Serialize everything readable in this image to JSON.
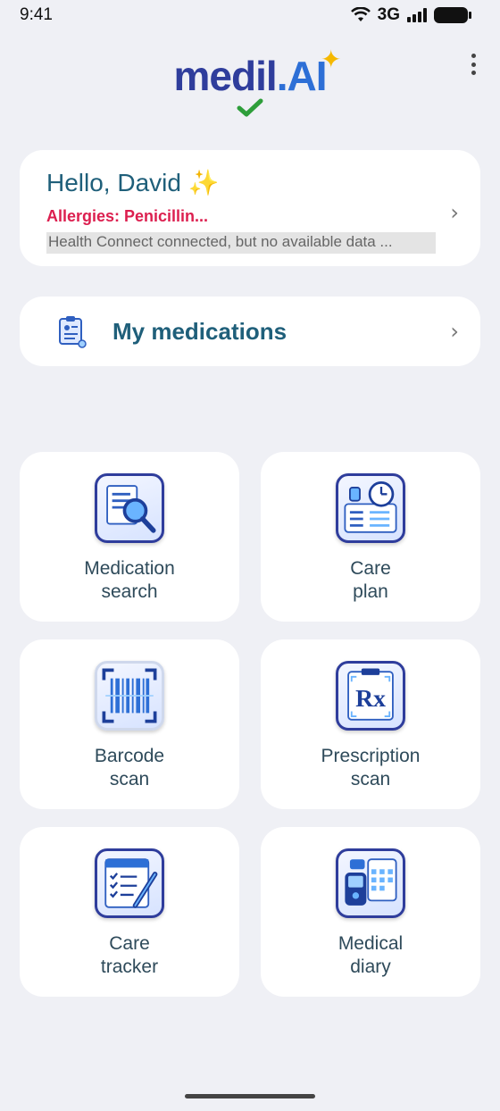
{
  "status_bar": {
    "time": "9:41",
    "network": "3G"
  },
  "logo": {
    "part1": "medil",
    "part2": ".AI"
  },
  "greeting": {
    "title": "Hello, David ✨",
    "allergies": "Allergies: Penicillin...",
    "health_status": "Health Connect connected, but no available data ..."
  },
  "medications": {
    "label": "My medications"
  },
  "tiles": [
    {
      "line1": "Medication",
      "line2": "search",
      "icon": "magnifier-icon"
    },
    {
      "line1": "Care",
      "line2": "plan",
      "icon": "clock-checklist-icon"
    },
    {
      "line1": "Barcode",
      "line2": "scan",
      "icon": "barcode-icon"
    },
    {
      "line1": "Prescription",
      "line2": "scan",
      "icon": "rx-icon"
    },
    {
      "line1": "Care",
      "line2": "tracker",
      "icon": "checklist-pen-icon"
    },
    {
      "line1": "Medical",
      "line2": "diary",
      "icon": "glucose-meter-icon"
    }
  ],
  "colors": {
    "background": "#eff0f5",
    "primary_text": "#1f5f7a",
    "allergy_red": "#dc1f4f",
    "logo_dark": "#2f3d9c",
    "logo_light": "#2d6fd6"
  }
}
